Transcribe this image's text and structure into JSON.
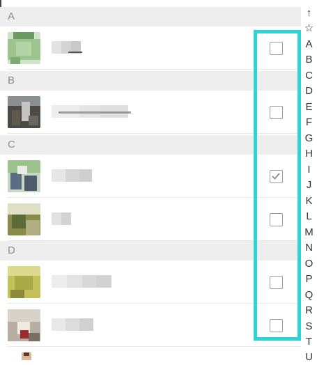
{
  "sections": [
    {
      "letter": "A",
      "contacts": [
        {
          "name": "",
          "checked": false
        }
      ]
    },
    {
      "letter": "B",
      "contacts": [
        {
          "name": "",
          "checked": false
        }
      ]
    },
    {
      "letter": "C",
      "contacts": [
        {
          "name": "",
          "checked": true
        },
        {
          "name": "",
          "checked": false
        }
      ]
    },
    {
      "letter": "D",
      "contacts": [
        {
          "name": "",
          "checked": false
        },
        {
          "name": "",
          "checked": false
        }
      ]
    }
  ],
  "index_bar": [
    "↑",
    "☆",
    "A",
    "B",
    "C",
    "D",
    "E",
    "F",
    "G",
    "H",
    "I",
    "J",
    "K",
    "L",
    "M",
    "N",
    "O",
    "P",
    "Q",
    "R",
    "S",
    "T",
    "U"
  ],
  "colors": {
    "highlight": "#2ed3d5",
    "section_bg": "#eeeeee",
    "checkbox_border": "#9a9a9a"
  },
  "icons": {
    "checkmark": "checkmark-icon",
    "scroll_top": "arrow-up-icon",
    "favorites": "star-icon"
  }
}
